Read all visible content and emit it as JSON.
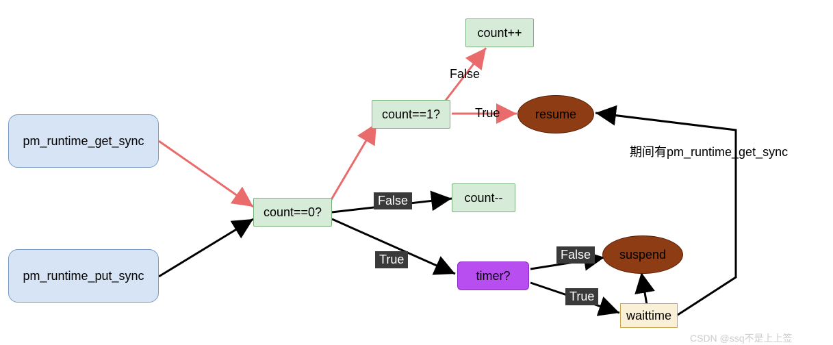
{
  "nodes": {
    "get_sync": "pm_runtime_get_sync",
    "put_sync": "pm_runtime_put_sync",
    "count0": "count==0?",
    "count1": "count==1?",
    "count_inc": "count++",
    "count_dec": "count--",
    "timer": "timer?",
    "resume": "resume",
    "suspend": "suspend",
    "waittime": "waittime"
  },
  "edges": {
    "count1_false": "False",
    "count1_true": "True",
    "count0_false": "False",
    "count0_true": "True",
    "timer_false": "False",
    "timer_true": "True",
    "waittime_to_resume": "期间有pm_runtime_get_sync"
  },
  "watermark": "CSDN @ssq不是上上签"
}
